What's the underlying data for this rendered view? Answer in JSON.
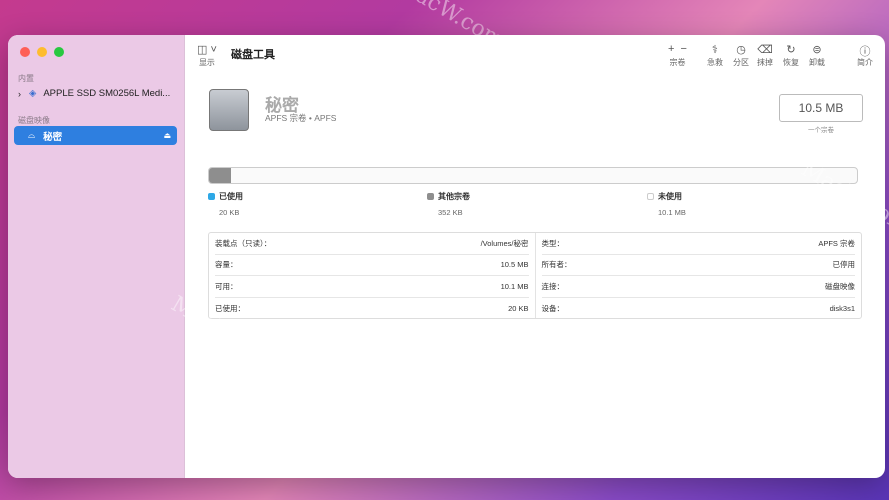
{
  "window": {
    "title": "磁盘工具",
    "view_label": "显示"
  },
  "sidebar": {
    "sections": [
      {
        "label": "内置",
        "items": [
          {
            "label": "APPLE SSD SM0256L Medi...",
            "icon": "stack-icon"
          }
        ]
      },
      {
        "label": "磁盘映像",
        "items": [
          {
            "label": "秘密",
            "icon": "drive-icon",
            "selected": true
          }
        ]
      }
    ]
  },
  "toolbar": [
    {
      "icon": "+ −",
      "label": "宗卷"
    },
    {
      "icon": "stethoscope",
      "label": "急救"
    },
    {
      "icon": "pie-clock",
      "label": "分区"
    },
    {
      "icon": "eraser-car",
      "label": "抹掉"
    },
    {
      "icon": "restore",
      "label": "恢复"
    },
    {
      "icon": "unmount",
      "label": "卸载"
    },
    {
      "icon": "info",
      "label": "简介"
    }
  ],
  "volume": {
    "name": "秘密",
    "subtitle": "APFS 宗卷 • APFS",
    "size": "10.5 MB",
    "size_caption": "一个宗卷"
  },
  "usage": {
    "used_percent": 3.4,
    "legend": [
      {
        "label": "已使用",
        "value": "20 KB",
        "color": "#2ea8e6"
      },
      {
        "label": "其他宗卷",
        "value": "352 KB",
        "color": "#8e8e8e"
      },
      {
        "label": "未使用",
        "value": "10.1 MB",
        "color": "#ffffff"
      }
    ]
  },
  "info": {
    "left": [
      {
        "k": "装载点（只读）：",
        "v": "/Volumes/秘密"
      },
      {
        "k": "容量：",
        "v": "10.5 MB"
      },
      {
        "k": "可用：",
        "v": "10.1 MB"
      },
      {
        "k": "已使用：",
        "v": "20 KB"
      }
    ],
    "right": [
      {
        "k": "类型：",
        "v": "APFS 宗卷"
      },
      {
        "k": "所有者：",
        "v": "已停用"
      },
      {
        "k": "连接：",
        "v": "磁盘映像"
      },
      {
        "k": "设备：",
        "v": "disk3s1"
      }
    ]
  },
  "watermark": "MacW.com"
}
